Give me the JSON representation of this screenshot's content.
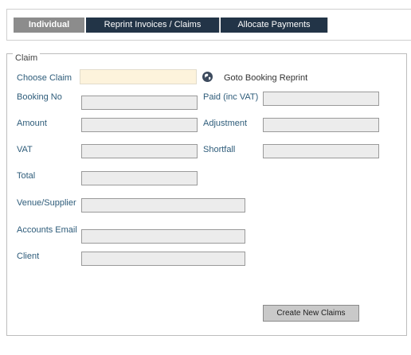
{
  "tabs": [
    {
      "label": "Individual"
    },
    {
      "label": "Reprint Invoices / Claims"
    },
    {
      "label": "Allocate Payments"
    }
  ],
  "claim": {
    "legend": "Claim",
    "choose_claim": {
      "label": "Choose Claim",
      "value": ""
    },
    "goto_booking_reprint": "Goto Booking Reprint",
    "booking_no": {
      "label": "Booking No",
      "value": ""
    },
    "paid_inc_vat": {
      "label": "Paid (inc VAT)",
      "value": ""
    },
    "amount": {
      "label": "Amount",
      "value": ""
    },
    "adjustment": {
      "label": "Adjustment",
      "value": ""
    },
    "vat": {
      "label": "VAT",
      "value": ""
    },
    "shortfall": {
      "label": "Shortfall",
      "value": ""
    },
    "total": {
      "label": "Total",
      "value": ""
    },
    "venue_supplier": {
      "label": "Venue/Supplier",
      "value": ""
    },
    "accounts_email": {
      "label": "Accounts Email",
      "value": ""
    },
    "client": {
      "label": "Client",
      "value": ""
    },
    "create_button": "Create New Claims"
  },
  "icons": {
    "goto": "globe-icon"
  }
}
